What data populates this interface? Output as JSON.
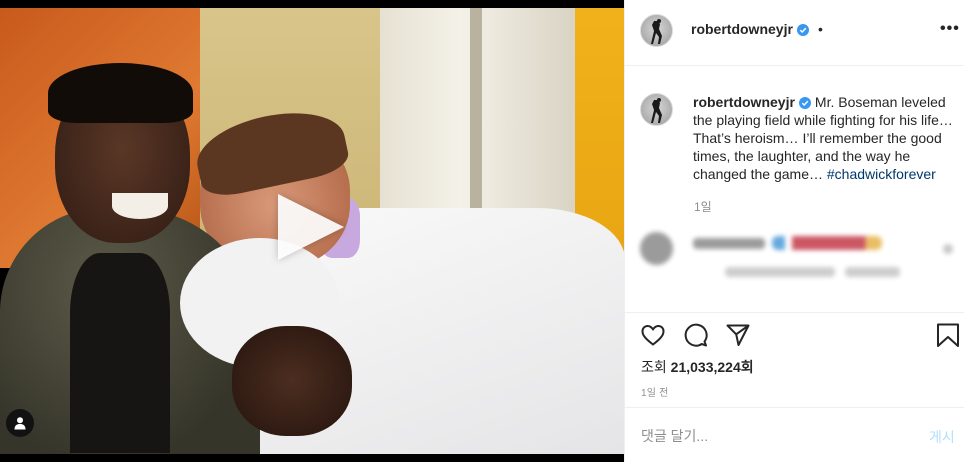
{
  "post": {
    "username": "robertdowneyjr",
    "header_separator": "•",
    "more_label": "•••",
    "caption_text": "Mr. Boseman leveled the playing field while fighting for his life… That’s heroism… I’ll remember the good times, the laughter, and the way he changed the game… ",
    "caption_hashtag": "#chadwickforever",
    "caption_time": "1일",
    "views_label": "조회",
    "views_count": "21,033,224회",
    "post_time": "1일 전"
  },
  "comment_box": {
    "placeholder": "댓글 달기...",
    "post_label": "게시"
  },
  "colors": {
    "verified": "#3897f0",
    "hashtag": "#00376b",
    "post_button_disabled": "#b2dffc",
    "secondary_text": "#8e8e8e"
  },
  "icons": [
    "verified-badge-icon",
    "more-options-icon",
    "play-icon",
    "user-tag-icon",
    "heart-icon",
    "comment-icon",
    "share-icon",
    "bookmark-icon"
  ]
}
